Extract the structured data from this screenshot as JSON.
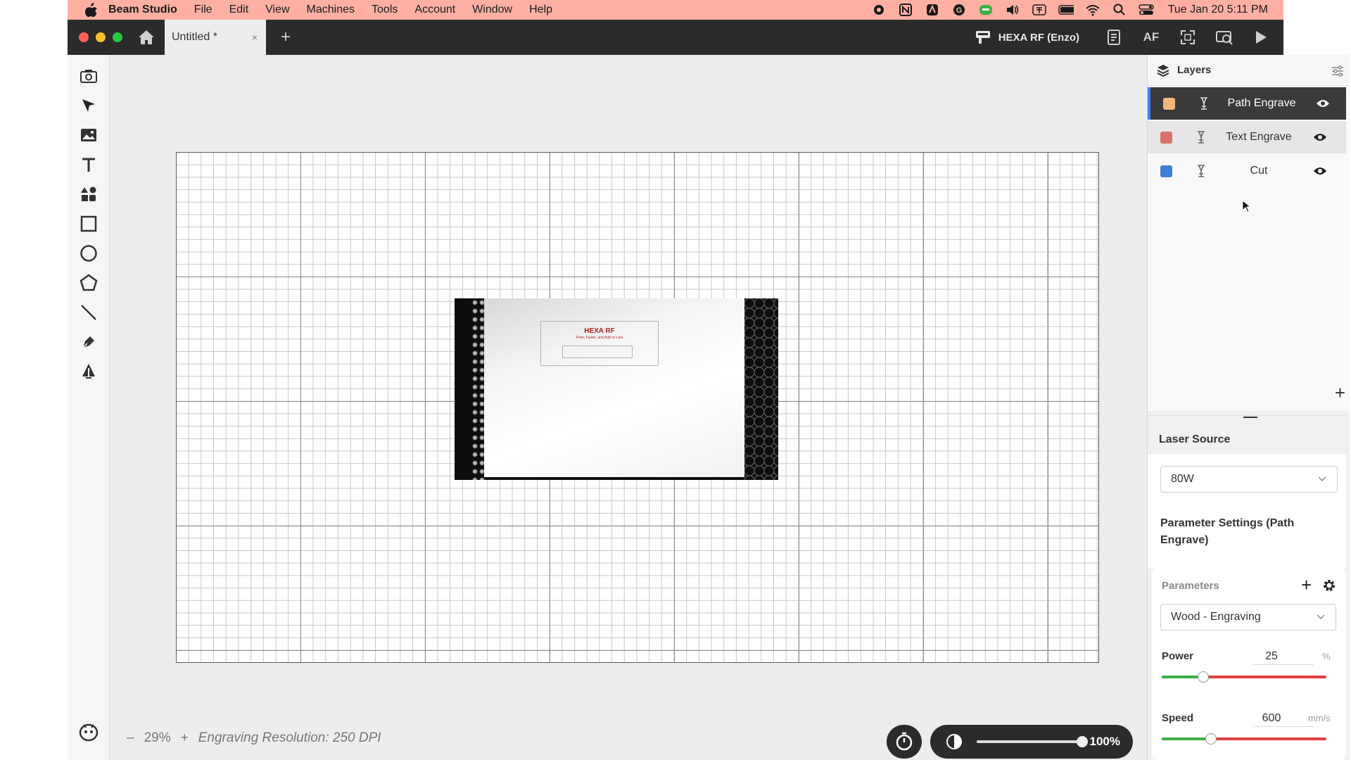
{
  "menubar": {
    "app_name": "Beam Studio",
    "items": [
      "File",
      "Edit",
      "View",
      "Machines",
      "Tools",
      "Account",
      "Window",
      "Help"
    ],
    "clock": "Tue Jan 20  5:11 PM"
  },
  "tabbar": {
    "tab_title": "Untitled *",
    "tab_close": "×",
    "new_tab": "+",
    "machine_name": "HEXA RF (Enzo)",
    "af_label": "AF"
  },
  "canvas": {
    "image_brand": "HEXA RF",
    "image_tagline": "Finer, Faster, and Built to Last",
    "zoom_minus": "–",
    "zoom_value": "29%",
    "zoom_plus": "+",
    "engraving_resolution": "Engraving Resolution: 250 DPI",
    "preview_opacity": "100%",
    "preview_opacity_value": 1.0
  },
  "layers": {
    "title": "Layers",
    "items": [
      {
        "name": "Path Engrave",
        "color": "#f2b87c",
        "state": "selected"
      },
      {
        "name": "Text Engrave",
        "color": "#d9706c",
        "state": "hovered"
      },
      {
        "name": "Cut",
        "color": "#3f7fd6",
        "state": "normal"
      }
    ],
    "add": "+"
  },
  "settings": {
    "laser_source_label": "Laser Source",
    "laser_source_value": "80W",
    "param_settings_title": "Parameter Settings (Path Engrave)",
    "parameters_label": "Parameters",
    "parameters_add": "+",
    "preset_value": "Wood - Engraving",
    "power_label": "Power",
    "power_value": "25",
    "power_unit": "%",
    "power_fraction": 0.25,
    "speed_label": "Speed",
    "speed_value": "600",
    "speed_unit": "mm/s",
    "speed_fraction": 0.3
  },
  "colors": {
    "menubar_bg": "#ffb0a3",
    "titlebar_bg": "#2b2b2b",
    "accent_blue": "#3b82f6",
    "slider_red": "#e0403a",
    "slider_green": "#3cb043"
  }
}
